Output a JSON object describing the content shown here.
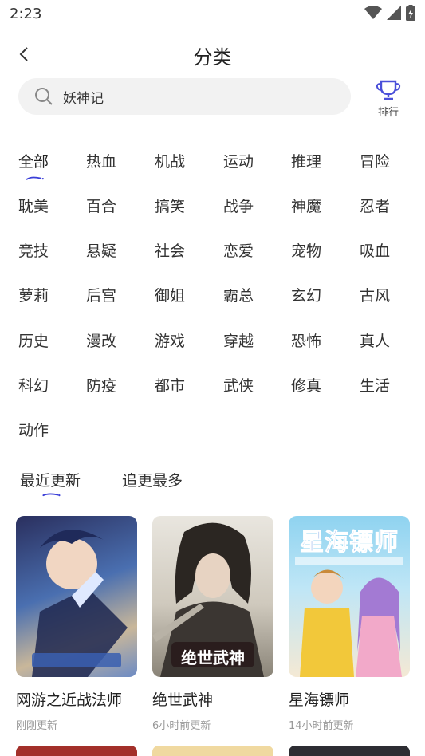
{
  "status": {
    "time": "2:23"
  },
  "header": {
    "title": "分类"
  },
  "search": {
    "value": "妖神记"
  },
  "rank": {
    "label": "排行"
  },
  "categories": [
    "全部",
    "热血",
    "机战",
    "运动",
    "推理",
    "冒险",
    "耽美",
    "百合",
    "搞笑",
    "战争",
    "神魔",
    "忍者",
    "竞技",
    "悬疑",
    "社会",
    "恋爱",
    "宠物",
    "吸血",
    "萝莉",
    "后宫",
    "御姐",
    "霸总",
    "玄幻",
    "古风",
    "历史",
    "漫改",
    "游戏",
    "穿越",
    "恐怖",
    "真人",
    "科幻",
    "防疫",
    "都市",
    "武侠",
    "修真",
    "生活",
    "动作"
  ],
  "active_category": "全部",
  "sort_tabs": [
    "最近更新",
    "追更最多"
  ],
  "active_sort": "最近更新",
  "comics": [
    {
      "name": "网游之近战法师",
      "time": "刚刚更新",
      "cover_text": ""
    },
    {
      "name": "绝世武神",
      "time": "6小时前更新",
      "cover_text": "绝世武神"
    },
    {
      "name": "星海镖师",
      "time": "14小时前更新",
      "cover_text": "星海镖师"
    }
  ],
  "colors": {
    "accent": "#3b3fd8",
    "search_bg": "#f2f2f2",
    "muted": "#999999"
  }
}
